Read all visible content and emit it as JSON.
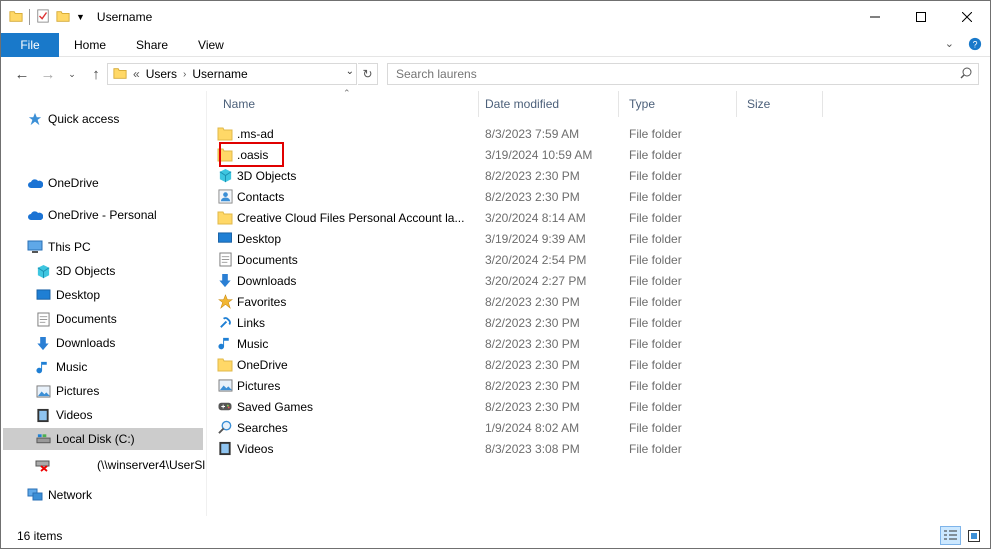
{
  "window": {
    "title": "Username"
  },
  "ribbon": {
    "tabs": [
      "File",
      "Home",
      "Share",
      "View"
    ]
  },
  "address": {
    "crumbs": [
      "Users",
      "Username"
    ],
    "overflow": "«"
  },
  "search": {
    "placeholder": "Search laurens"
  },
  "nav": {
    "quick_access": "Quick access",
    "onedrive": "OneDrive",
    "onedrive_personal": "OneDrive - Personal",
    "this_pc": "This PC",
    "pc_items": [
      "3D Objects",
      "Desktop",
      "Documents",
      "Downloads",
      "Music",
      "Pictures",
      "Videos",
      "Local Disk (C:)"
    ],
    "network_drive": "(\\\\winserver4\\UserSl",
    "network": "Network"
  },
  "columns": {
    "name": "Name",
    "date": "Date modified",
    "type": "Type",
    "size": "Size"
  },
  "files": [
    {
      "name": ".ms-ad",
      "date": "8/3/2023 7:59 AM",
      "type": "File folder",
      "icon": "folder-icon"
    },
    {
      "name": ".oasis",
      "date": "3/19/2024 10:59 AM",
      "type": "File folder",
      "icon": "folder-icon"
    },
    {
      "name": "3D Objects",
      "date": "8/2/2023 2:30 PM",
      "type": "File folder",
      "icon": "cube-icon"
    },
    {
      "name": "Contacts",
      "date": "8/2/2023 2:30 PM",
      "type": "File folder",
      "icon": "contacts-icon"
    },
    {
      "name": "Creative Cloud Files Personal Account la...",
      "date": "3/20/2024 8:14 AM",
      "type": "File folder",
      "icon": "folder-icon"
    },
    {
      "name": "Desktop",
      "date": "3/19/2024 9:39 AM",
      "type": "File folder",
      "icon": "desktop-icon"
    },
    {
      "name": "Documents",
      "date": "3/20/2024 2:54 PM",
      "type": "File folder",
      "icon": "documents-icon"
    },
    {
      "name": "Downloads",
      "date": "3/20/2024 2:27 PM",
      "type": "File folder",
      "icon": "download-icon"
    },
    {
      "name": "Favorites",
      "date": "8/2/2023 2:30 PM",
      "type": "File folder",
      "icon": "star-icon"
    },
    {
      "name": "Links",
      "date": "8/2/2023 2:30 PM",
      "type": "File folder",
      "icon": "link-icon"
    },
    {
      "name": "Music",
      "date": "8/2/2023 2:30 PM",
      "type": "File folder",
      "icon": "music-icon"
    },
    {
      "name": "OneDrive",
      "date": "8/2/2023 2:30 PM",
      "type": "File folder",
      "icon": "folder-icon"
    },
    {
      "name": "Pictures",
      "date": "8/2/2023 2:30 PM",
      "type": "File folder",
      "icon": "pictures-icon"
    },
    {
      "name": "Saved Games",
      "date": "8/2/2023 2:30 PM",
      "type": "File folder",
      "icon": "gamepad-icon"
    },
    {
      "name": "Searches",
      "date": "1/9/2024 8:02 AM",
      "type": "File folder",
      "icon": "search-icon"
    },
    {
      "name": "Videos",
      "date": "8/3/2023 3:08 PM",
      "type": "File folder",
      "icon": "video-icon"
    }
  ],
  "status": {
    "count": "16 items"
  },
  "colors": {
    "accent": "#1979ca",
    "highlight": "#e00000",
    "folder": "#ffd867"
  }
}
